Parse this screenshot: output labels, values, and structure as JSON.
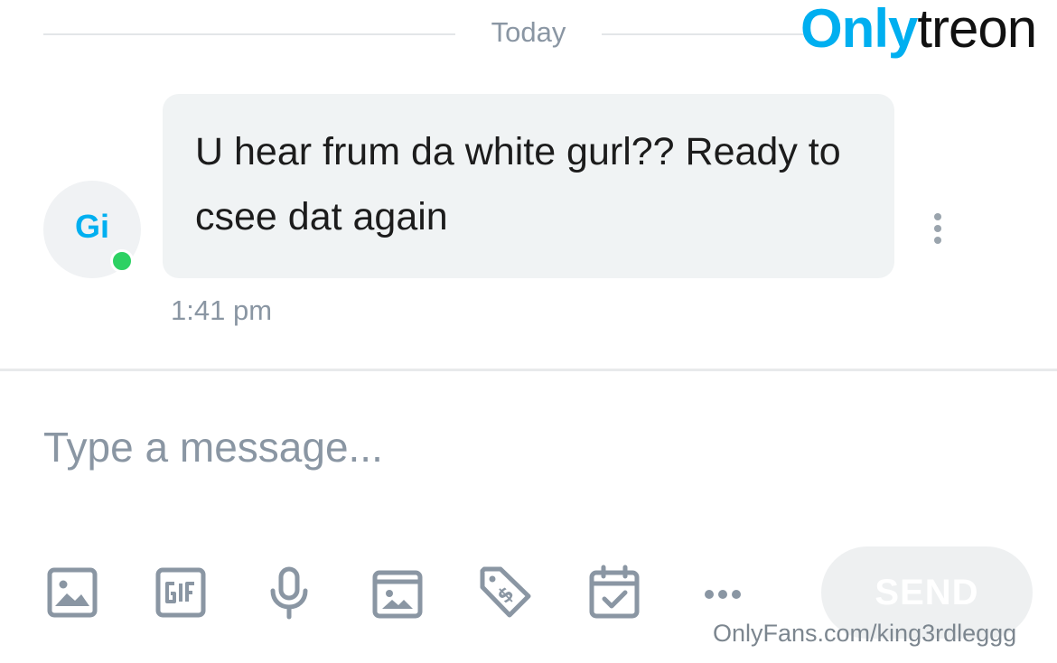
{
  "date_separator": {
    "label": "Today"
  },
  "watermark": {
    "logo_part1": "Only",
    "logo_part2": "treon",
    "url": "OnlyFans.com/king3rdleggg"
  },
  "message": {
    "avatar_initials": "Gi",
    "online": true,
    "text": "U hear frum da white gurl?? Ready to csee dat again",
    "time": "1:41 pm",
    "menu_icon": "more-vertical-icon"
  },
  "composer": {
    "placeholder": "Type a message...",
    "value": "",
    "toolbar": [
      {
        "name": "image-icon",
        "label": "Image"
      },
      {
        "name": "gif-icon",
        "label": "GIF"
      },
      {
        "name": "microphone-icon",
        "label": "Voice"
      },
      {
        "name": "vault-icon",
        "label": "Vault"
      },
      {
        "name": "price-tag-icon",
        "label": "Price"
      },
      {
        "name": "calendar-check-icon",
        "label": "Schedule"
      },
      {
        "name": "more-horizontal-icon",
        "label": "More"
      }
    ],
    "send_label": "SEND"
  },
  "colors": {
    "accent": "#00aff0",
    "icon_gray": "#8a96a3",
    "online_green": "#2dd163",
    "bubble_bg": "#f0f3f4"
  }
}
